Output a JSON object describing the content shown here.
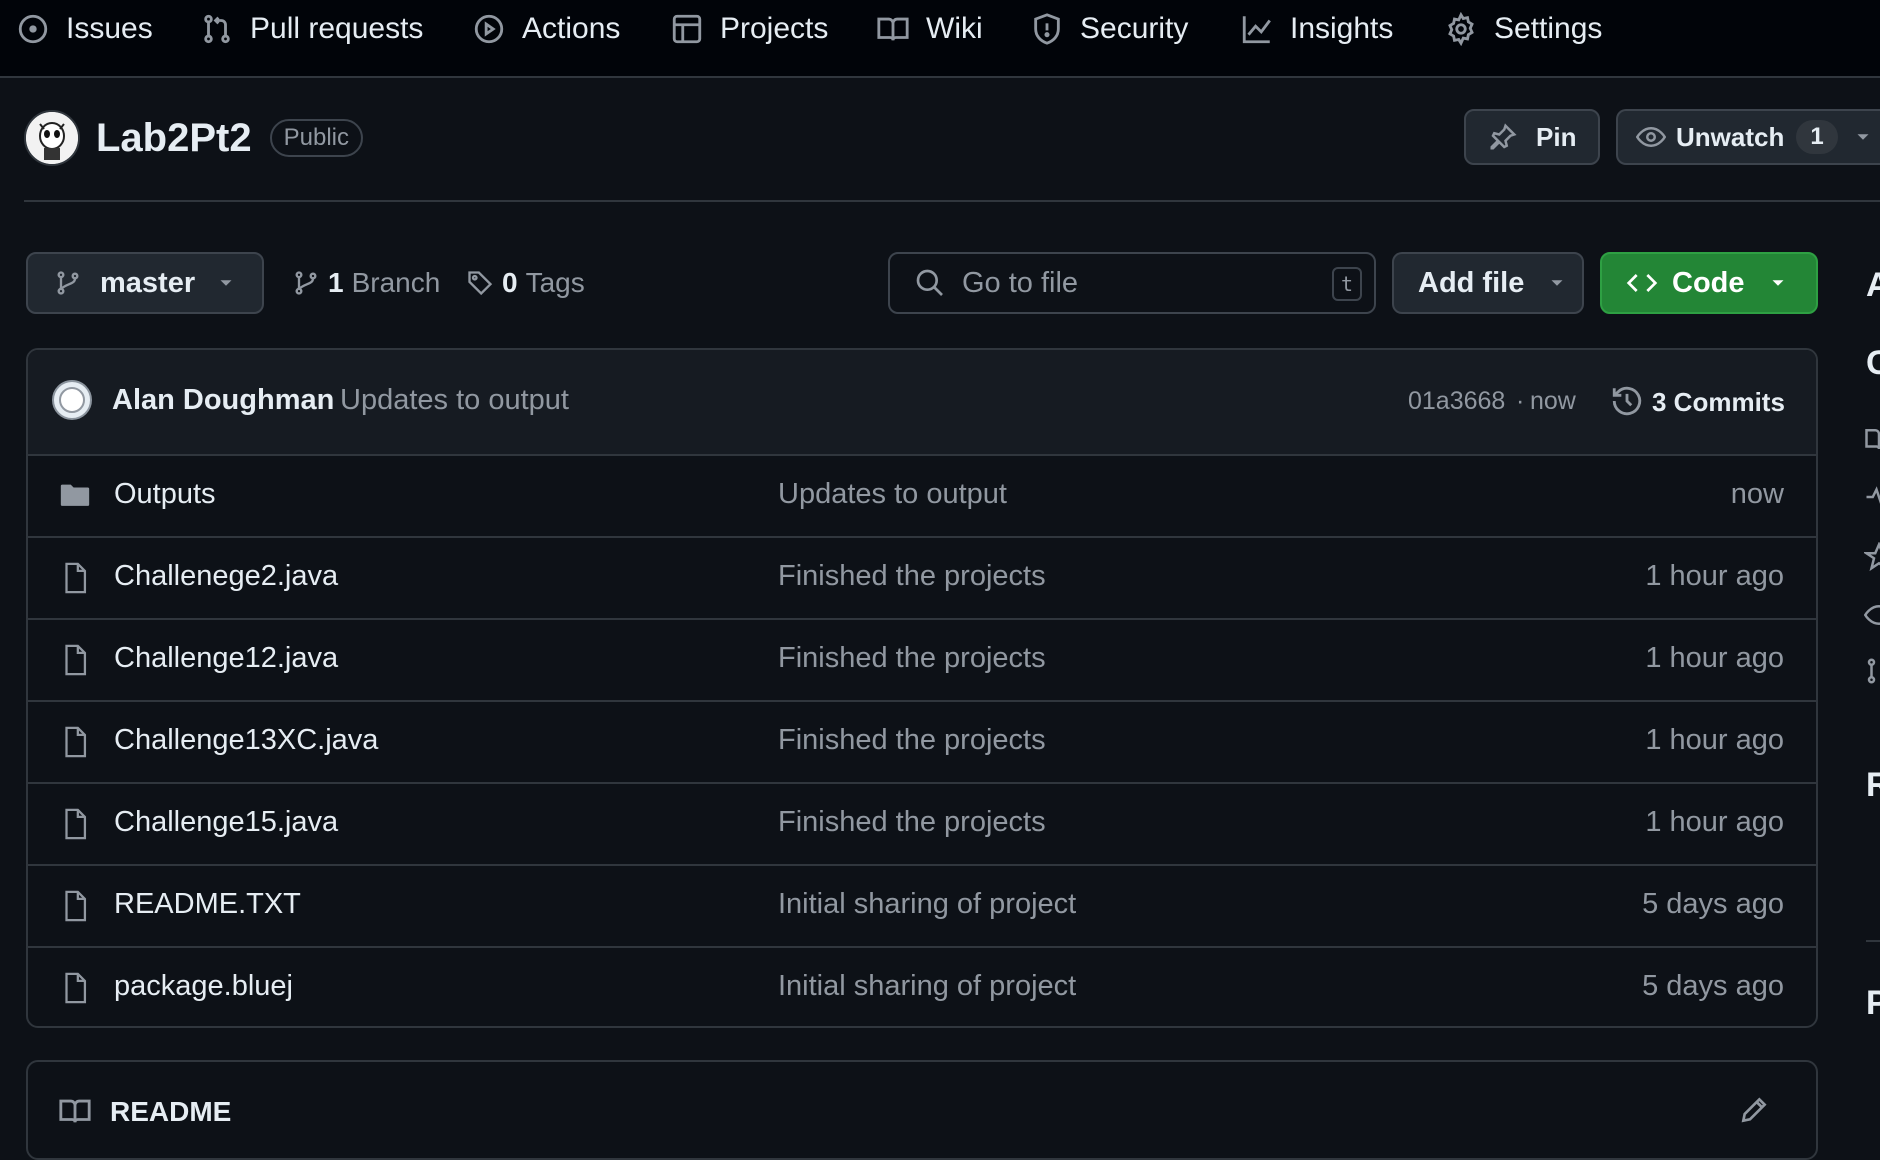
{
  "nav": {
    "items": [
      {
        "label": "Issues",
        "icon": "issue-icon"
      },
      {
        "label": "Pull requests",
        "icon": "pull-request-icon"
      },
      {
        "label": "Actions",
        "icon": "play-icon"
      },
      {
        "label": "Projects",
        "icon": "table-icon"
      },
      {
        "label": "Wiki",
        "icon": "book-icon"
      },
      {
        "label": "Security",
        "icon": "shield-icon"
      },
      {
        "label": "Insights",
        "icon": "graph-icon"
      },
      {
        "label": "Settings",
        "icon": "gear-icon"
      }
    ]
  },
  "repo": {
    "name": "Lab2Pt2",
    "visibility": "Public",
    "pin_label": "Pin",
    "watch_label": "Unwatch",
    "watch_count": "1"
  },
  "toolbar": {
    "branch": "master",
    "branches_count": "1",
    "branches_label": "Branch",
    "tags_count": "0",
    "tags_label": "Tags",
    "search_placeholder": "Go to file",
    "search_key": "t",
    "add_file_label": "Add file",
    "code_label": "Code"
  },
  "latest_commit": {
    "author": "Alan Doughman",
    "message": "Updates to output",
    "sha": "01a3668",
    "separator": "·",
    "time": "now",
    "commits_label": "3 Commits"
  },
  "files": [
    {
      "type": "folder",
      "name": "Outputs",
      "message": "Updates to output",
      "time": "now"
    },
    {
      "type": "file",
      "name": "Challenege2.java",
      "message": "Finished the projects",
      "time": "1 hour ago"
    },
    {
      "type": "file",
      "name": "Challenge12.java",
      "message": "Finished the projects",
      "time": "1 hour ago"
    },
    {
      "type": "file",
      "name": "Challenge13XC.java",
      "message": "Finished the projects",
      "time": "1 hour ago"
    },
    {
      "type": "file",
      "name": "Challenge15.java",
      "message": "Finished the projects",
      "time": "1 hour ago"
    },
    {
      "type": "file",
      "name": "README.TXT",
      "message": "Initial sharing of project",
      "time": "5 days ago"
    },
    {
      "type": "file",
      "name": "package.bluej",
      "message": "Initial sharing of project",
      "time": "5 days ago"
    }
  ],
  "readme": {
    "title": "README"
  },
  "sidebar_partial": {
    "letters": [
      "A",
      "C",
      "R",
      "P"
    ]
  },
  "colors": {
    "background": "#0d1117",
    "code_button": "#238636",
    "border": "#30363d",
    "muted_text": "#9198a1"
  }
}
